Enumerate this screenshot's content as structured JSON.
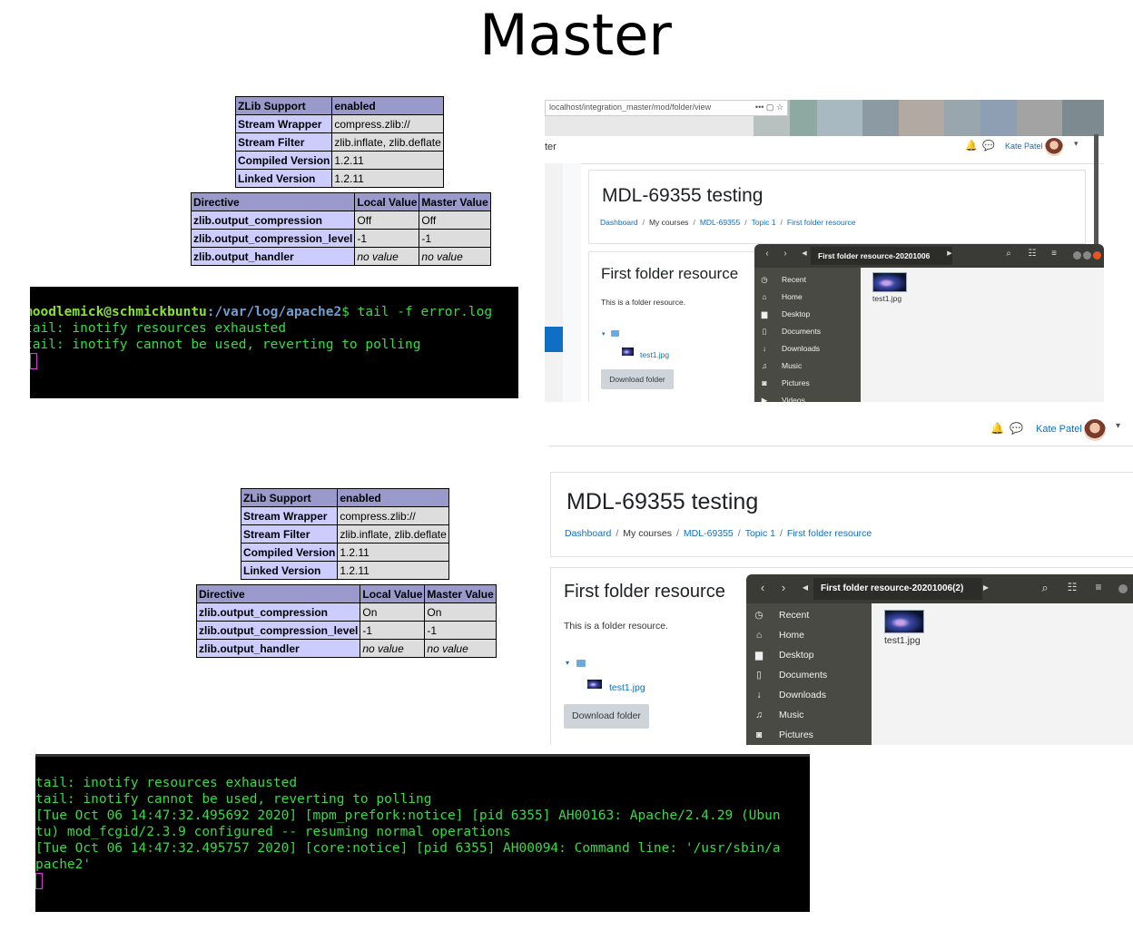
{
  "heading": "Master",
  "zlib_top": [
    {
      "k": "ZLib Support",
      "v": "enabled"
    },
    {
      "k": "Stream Wrapper",
      "v": "compress.zlib://"
    },
    {
      "k": "Stream Filter",
      "v": "zlib.inflate, zlib.deflate"
    },
    {
      "k": "Compiled Version",
      "v": "1.2.11"
    },
    {
      "k": "Linked Version",
      "v": "1.2.11"
    }
  ],
  "dir_headers": [
    "Directive",
    "Local Value",
    "Master Value"
  ],
  "dir_top": [
    {
      "d": "zlib.output_compression",
      "l": "Off",
      "m": "Off"
    },
    {
      "d": "zlib.output_compression_level",
      "l": "-1",
      "m": "-1"
    },
    {
      "d": "zlib.output_handler",
      "l": "no value",
      "m": "no value"
    }
  ],
  "dir_bottom": [
    {
      "d": "zlib.output_compression",
      "l": "On",
      "m": "On"
    },
    {
      "d": "zlib.output_compression_level",
      "l": "-1",
      "m": "-1"
    },
    {
      "d": "zlib.output_handler",
      "l": "no value",
      "m": "no value"
    }
  ],
  "term1": {
    "user": "moodlemick@schmickbuntu",
    "path": ":/var/log/apache2",
    "cmd": "$ tail -f error.log",
    "lines": [
      "tail: inotify resources exhausted",
      "tail: inotify cannot be used, reverting to polling"
    ]
  },
  "term2": {
    "lines": [
      "tail: inotify resources exhausted",
      "tail: inotify cannot be used, reverting to polling",
      "[Tue Oct 06 14:47:32.495692 2020] [mpm_prefork:notice] [pid 6355] AH00163: Apache/2.4.29 (Ubun",
      "tu) mod_fcgid/2.3.9 configured -- resuming normal operations",
      "[Tue Oct 06 14:47:32.495757 2020] [core:notice] [pid 6355] AH00094: Command line: '/usr/sbin/a",
      "pache2'"
    ]
  },
  "browser": {
    "url": "localhost/integration_master/mod/folder/view",
    "ellipsis": "•••",
    "tab_fragment": "ter"
  },
  "moodle": {
    "user": "Kate Patel",
    "course_title": "MDL-69355 testing",
    "breadcrumb": [
      "Dashboard",
      "My courses",
      "MDL-69355",
      "Topic 1",
      "First folder resource"
    ],
    "resource_title": "First folder resource",
    "resource_desc": "This is a folder resource.",
    "file_name": "test1.jpg",
    "download_label": "Download folder"
  },
  "nautilus_top": {
    "path": "First folder resource-20201006",
    "sidebar": [
      "Recent",
      "Home",
      "Desktop",
      "Documents",
      "Downloads",
      "Music",
      "Pictures",
      "Videos"
    ],
    "file": "test1.jpg"
  },
  "nautilus_bottom": {
    "path": "First folder resource-20201006(2)",
    "sidebar": [
      "Recent",
      "Home",
      "Desktop",
      "Documents",
      "Downloads",
      "Music",
      "Pictures"
    ],
    "file": "test1.jpg"
  }
}
